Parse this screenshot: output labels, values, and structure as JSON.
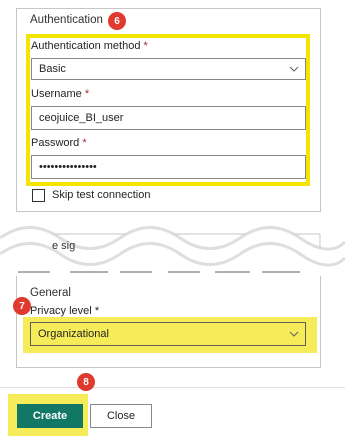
{
  "authentication": {
    "title": "Authentication",
    "method_label": "Authentication method",
    "method_value": "Basic",
    "username_label": "Username",
    "username_value": "ceojuice_BI_user",
    "password_label": "Password",
    "password_value": "•••••••••••••••",
    "skip_test_label": "Skip test connection",
    "required_marker": "*"
  },
  "partial_text": "e sig",
  "general": {
    "title": "General",
    "privacy_label": "Privacy level",
    "privacy_value": "Organizational"
  },
  "footer": {
    "create_label": "Create",
    "close_label": "Close"
  },
  "badges": [
    "6",
    "7",
    "8"
  ],
  "colors": {
    "highlight": "#f2e600",
    "badge": "#e03a2e",
    "primary_button": "#117865",
    "required": "#a4262c"
  }
}
